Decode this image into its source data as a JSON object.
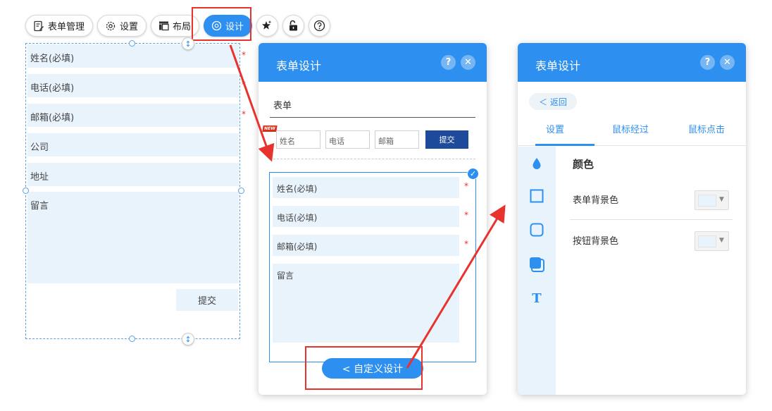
{
  "toolbar": {
    "form_manage": "表单管理",
    "settings": "设置",
    "layout": "布局",
    "design": "设计"
  },
  "left_form": {
    "fields": [
      {
        "label": "姓名(必填)",
        "required": true
      },
      {
        "label": "电话(必填)",
        "required": true
      },
      {
        "label": "邮箱(必填)",
        "required": true
      },
      {
        "label": "公司",
        "required": false
      },
      {
        "label": "地址",
        "required": false
      },
      {
        "label": "留言",
        "required": false
      }
    ],
    "submit": "提交",
    "required_mark": "*"
  },
  "mid_panel": {
    "title": "表单设计",
    "form_title": "表单",
    "new_badge": "NEW",
    "mini_inputs": [
      "姓名",
      "电话",
      "邮箱"
    ],
    "mini_submit": "提交",
    "fields": [
      "姓名(必填)",
      "电话(必填)",
      "邮箱(必填)",
      "留言"
    ],
    "custom_button": "< 自定义设计"
  },
  "right_panel": {
    "title": "表单设计",
    "back": "＜ 返回",
    "tabs": [
      "设置",
      "鼠标经过",
      "鼠标点击"
    ],
    "section_heading": "颜色",
    "rows": [
      {
        "label": "表单背景色",
        "color": "#e8f3fc"
      },
      {
        "label": "按钮背景色",
        "color": "#e8f3fc"
      }
    ]
  },
  "colors": {
    "accent": "#2d8ff0",
    "annotation": "#e8322e",
    "field_bg": "#e8f3fc",
    "submit_dark": "#1d4a9a"
  },
  "icons": {
    "help": "?",
    "close": "✕",
    "check": "✓",
    "text": "T"
  }
}
